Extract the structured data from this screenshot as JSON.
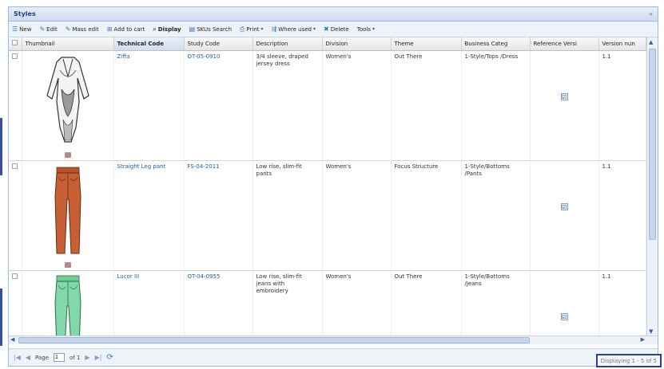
{
  "panel": {
    "title": "Styles"
  },
  "toolbar": [
    {
      "icon": "☰",
      "label": "New"
    },
    {
      "icon": "✎",
      "label": "Edit"
    },
    {
      "icon": "✎",
      "label": "Mass edit"
    },
    {
      "icon": "⊞",
      "label": "Add to cart"
    },
    {
      "icon": "⌕",
      "label": "Display",
      "bold": true
    },
    {
      "icon": "▤",
      "label": "SKUs Search"
    },
    {
      "icon": "⎙",
      "label": "Print",
      "menu": true
    },
    {
      "icon": "⇶",
      "label": "Where used",
      "menu": true
    },
    {
      "icon": "✖",
      "label": "Delete"
    },
    {
      "icon": "",
      "label": "Tools",
      "menu": true
    }
  ],
  "columns": [
    "Thumbnail",
    "Technical Code",
    "Study Code",
    "Description",
    "Division",
    "Theme",
    "Business Categ",
    "Reference Versi",
    "Version nun"
  ],
  "rows": [
    {
      "thumbnail": "dress",
      "technical_code": "Ziffa",
      "study_code": "OT-05-0910",
      "description": "3/4 sleeve, draped jersey dress",
      "division": "Women's",
      "theme": "Out There",
      "business_category": "1-Style/Tops /Dress",
      "reference_version": "☑",
      "version_number": "1.1"
    },
    {
      "thumbnail": "orange-pants",
      "technical_code": "Straight Leg pant",
      "study_code": "FS-04-2011",
      "description": "Low rise, slim-fit pants",
      "division": "Women's",
      "theme": "Focus Structure",
      "business_category": "1-Style/Bottoms /Pants",
      "reference_version": "☑",
      "version_number": "1.1"
    },
    {
      "thumbnail": "green-jeans",
      "technical_code": "Lucor III",
      "study_code": "OT-04-0955",
      "description": "Low rise, slim-fit jeans with embroidery",
      "division": "Women's",
      "theme": "Out There",
      "business_category": "1-Style/Bottoms /Jeans",
      "reference_version": "☑",
      "version_number": "1.1"
    }
  ],
  "pager": {
    "page_label": "Page",
    "page_value": "1",
    "of_label": "of 1",
    "display_info": "Displaying 1 - 5 of 5"
  },
  "colors": {
    "accent": "#3a4fa0",
    "header_title": "#15428b",
    "link": "#1a5fb4"
  }
}
